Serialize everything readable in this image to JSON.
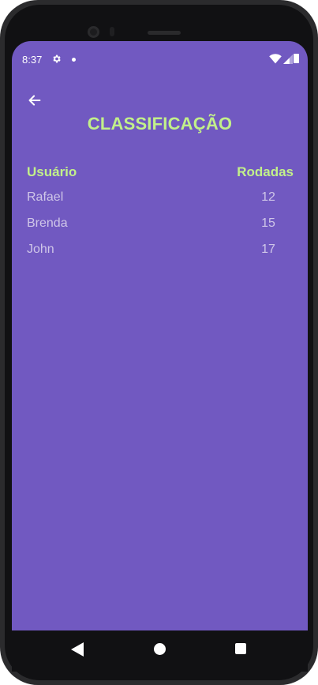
{
  "status_bar": {
    "time": "8:37",
    "icons": [
      "settings-gear-icon",
      "notification-dot-icon",
      "wifi-icon",
      "signal-icon",
      "battery-icon"
    ]
  },
  "header": {
    "back_icon": "arrow-back-icon",
    "title": "CLASSIFICAÇÃO"
  },
  "table": {
    "columns": [
      "Usuário",
      "Rodadas"
    ],
    "rows": [
      {
        "user": "Rafael",
        "rounds": "12"
      },
      {
        "user": "Brenda",
        "rounds": "15"
      },
      {
        "user": "John",
        "rounds": "17"
      }
    ]
  },
  "nav_bar": {
    "icons": [
      "nav-back-icon",
      "nav-home-icon",
      "nav-recents-icon"
    ]
  },
  "colors": {
    "background": "#7159c1",
    "accent": "#c2f08a",
    "row_text": "#cfc6e8"
  }
}
